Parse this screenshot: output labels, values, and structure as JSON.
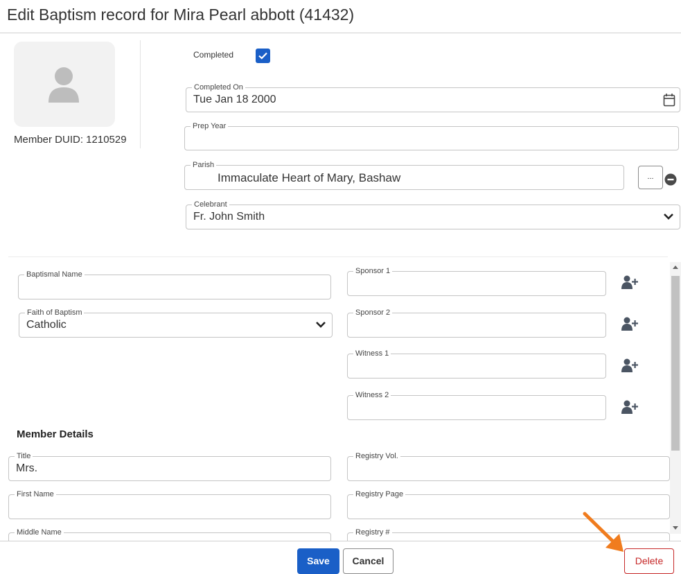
{
  "dialog": {
    "title": "Edit Baptism record for Mira Pearl abbott (41432)"
  },
  "member": {
    "duid_label": "Member DUID: 1210529"
  },
  "form": {
    "completed_label": "Completed",
    "completed_checked": true,
    "completed_on": {
      "label": "Completed On",
      "value": "Tue Jan 18 2000"
    },
    "prep_year": {
      "label": "Prep Year",
      "value": ""
    },
    "parish": {
      "label": "Parish",
      "value": "Immaculate Heart of Mary, Bashaw",
      "browse_label": "..."
    },
    "celebrant": {
      "label": "Celebrant",
      "value": "Fr. John Smith"
    },
    "baptismal_name": {
      "label": "Baptismal Name",
      "value": ""
    },
    "faith_of_baptism": {
      "label": "Faith of Baptism",
      "value": "Catholic"
    },
    "sponsor1": {
      "label": "Sponsor 1",
      "value": ""
    },
    "sponsor2": {
      "label": "Sponsor 2",
      "value": ""
    },
    "witness1": {
      "label": "Witness 1",
      "value": ""
    },
    "witness2": {
      "label": "Witness 2",
      "value": ""
    }
  },
  "member_details": {
    "section_title": "Member Details",
    "title": {
      "label": "Title",
      "value": "Mrs."
    },
    "first_name": {
      "label": "First Name",
      "value": ""
    },
    "middle_name": {
      "label": "Middle Name",
      "value": ""
    },
    "registry_vol": {
      "label": "Registry Vol.",
      "value": ""
    },
    "registry_page": {
      "label": "Registry Page",
      "value": ""
    },
    "registry_no": {
      "label": "Registry #",
      "value": ""
    }
  },
  "footer": {
    "save_label": "Save",
    "cancel_label": "Cancel",
    "delete_label": "Delete"
  },
  "icons": {
    "avatar": "person-silhouette-icon",
    "calendar": "calendar-icon",
    "chevron": "chevron-down-icon",
    "remove": "minus-circle-icon",
    "add_person": "person-plus-icon",
    "annotation": "orange-arrow-icon"
  },
  "colors": {
    "primary": "#1a5fc7",
    "danger": "#c62828",
    "annotation": "#f07c1e"
  }
}
